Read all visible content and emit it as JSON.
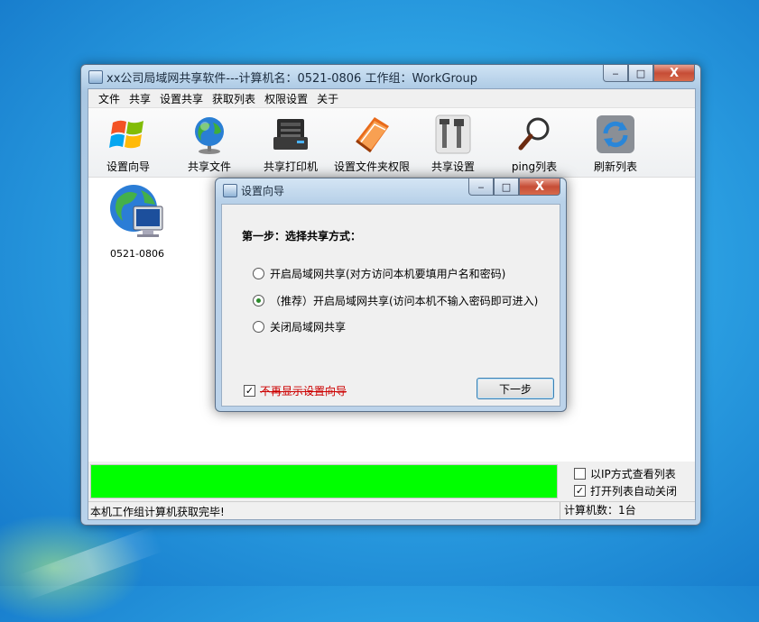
{
  "window": {
    "title": "xx公司局域网共享软件---计算机名：0521-0806  工作组：WorkGroup",
    "min": "‒",
    "max": "□",
    "close": "X"
  },
  "menu": [
    "文件",
    "共享",
    "设置共享",
    "获取列表",
    "权限设置",
    "关于"
  ],
  "toolbar": [
    {
      "label": "设置向导",
      "icon": "windows-flag-icon"
    },
    {
      "label": "共享文件",
      "icon": "globe-icon"
    },
    {
      "label": "共享打印机",
      "icon": "printer-icon"
    },
    {
      "label": "设置文件夹权限",
      "icon": "folder-book-icon"
    },
    {
      "label": "共享设置",
      "icon": "tools-icon"
    },
    {
      "label": "ping列表",
      "icon": "magnifier-icon"
    },
    {
      "label": "刷新列表",
      "icon": "refresh-icon"
    }
  ],
  "computer": {
    "name": "0521-0806"
  },
  "options": {
    "ip_view": "以IP方式查看列表",
    "auto_close": "打开列表自动关闭"
  },
  "status": {
    "message": "本机工作组计算机获取完毕!",
    "count": "计算机数：1台"
  },
  "dialog": {
    "title": "设置向导",
    "step": "第一步：选择共享方式：",
    "radios": [
      "开启局域网共享(对方访问本机要填用户名和密码)",
      "（推荐）开启局域网共享(访问本机不输入密码即可进入)",
      "关闭局域网共享"
    ],
    "selected": 1,
    "dont_show": "不再显示设置向导",
    "next": "下一步"
  },
  "colors": {
    "progress": "#00ff00",
    "close": "#c64d36"
  }
}
